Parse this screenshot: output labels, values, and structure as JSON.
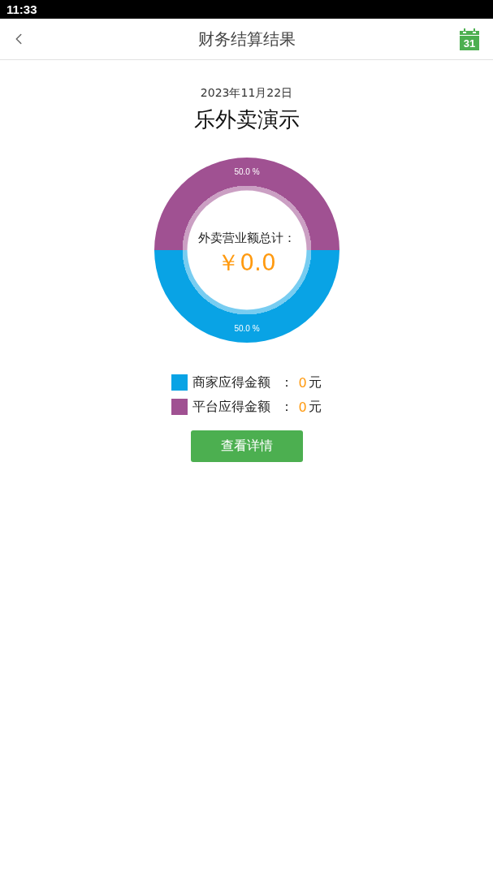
{
  "status_bar": {
    "time": "11:33"
  },
  "header": {
    "title": "财务结算结果",
    "calendar_day": "31"
  },
  "report": {
    "date": "2023年11月22日",
    "store_name": "乐外卖演示"
  },
  "chart": {
    "center_label": "外卖营业额总计：",
    "total": "￥0.0",
    "chart_data": {
      "type": "donut",
      "values": [
        50,
        50
      ],
      "value_labels": [
        "50.0 %",
        "50.0 %"
      ]
    }
  },
  "legend": [
    {
      "label": "商家应得金额",
      "separator": "：",
      "value": "0",
      "unit": "元",
      "color": "#09a3e5"
    },
    {
      "label": "平台应得金额",
      "separator": "：",
      "value": "0",
      "unit": "元",
      "color": "#a05192"
    }
  ],
  "details_button": {
    "label": "查看详情"
  }
}
